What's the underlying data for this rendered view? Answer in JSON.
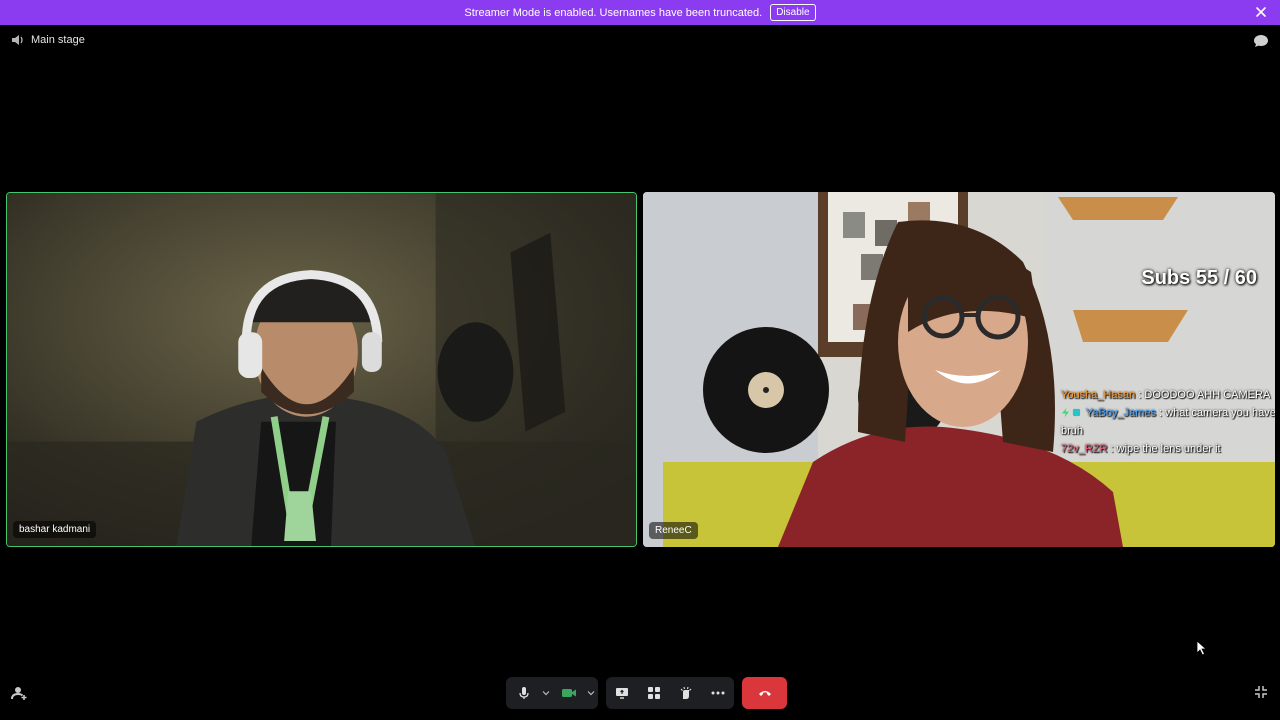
{
  "banner": {
    "message": "Streamer Mode is enabled. Usernames have been truncated.",
    "disable_label": "Disable",
    "background": "#8c3cf0"
  },
  "header": {
    "title": "Main stage",
    "icons": [
      "stage-icon",
      "chat-icon"
    ]
  },
  "participants": [
    {
      "name": "bashar kadmani",
      "speaking": true
    },
    {
      "name": "ReneeC",
      "speaking": false
    }
  ],
  "stream_overlay": {
    "subs_text": "Subs 55 / 60",
    "chat": [
      {
        "user": "Yousha_Hasan",
        "message": ": DOODOO AHH CAMERA"
      },
      {
        "user": "YaBoy_James",
        "message": ": what camera you have bruh"
      },
      {
        "user": "72v_RZR",
        "message": ": wipe the lens under it"
      }
    ]
  },
  "controls": {
    "icons": [
      "invite-icon",
      "mic-icon",
      "camera-icon",
      "screen-share-icon",
      "activities-icon",
      "soundboard-icon",
      "more-icon",
      "hang-up-icon",
      "fullscreen-exit-icon"
    ],
    "camera_on": true,
    "colors": {
      "speaking_border": "#46c46e",
      "hangup": "#da373c",
      "camera_active": "#3ba55d",
      "control_bg": "#1e1f22"
    }
  }
}
